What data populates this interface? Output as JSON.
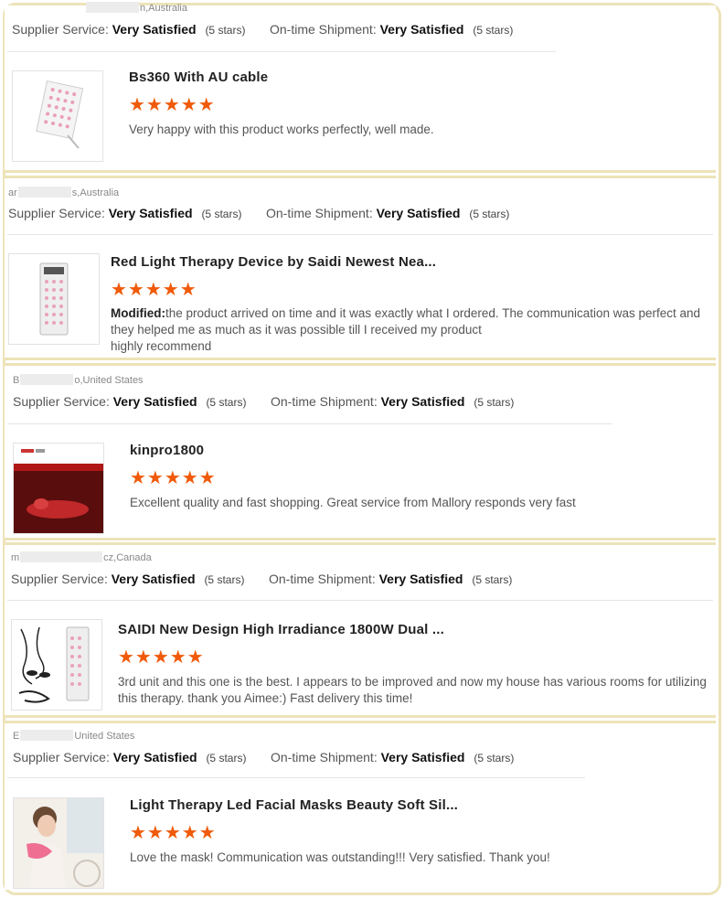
{
  "reviews": [
    {
      "buyer_prefix": "",
      "buyer_suffix": "n,Australia",
      "supplier_label": "Supplier Service:",
      "supplier_value": "Very Satisfied",
      "supplier_count": "(5 stars)",
      "shipment_label": "On-time Shipment:",
      "shipment_value": "Very Satisfied",
      "shipment_count": "(5 stars)",
      "product_title": "Bs360 With AU cable",
      "stars": "★★★★★",
      "rating": 5,
      "modified_label": "",
      "text": "Very happy with this product works perfectly, well made."
    },
    {
      "buyer_prefix": "ar",
      "buyer_suffix": "s,Australia",
      "supplier_label": "Supplier Service:",
      "supplier_value": "Very Satisfied",
      "supplier_count": "(5 stars)",
      "shipment_label": "On-time Shipment:",
      "shipment_value": "Very Satisfied",
      "shipment_count": "(5 stars)",
      "product_title": "Red Light Therapy Device by Saidi Newest Nea...",
      "stars": "★★★★★",
      "rating": 5,
      "modified_label": "Modified:",
      "text": "the product arrived on time and it was exactly what I ordered. The communication was perfect and they helped me as much as it was possible till I received my product",
      "text2": "highly recommend"
    },
    {
      "buyer_prefix": "B",
      "buyer_suffix": "o,United States",
      "supplier_label": "Supplier Service:",
      "supplier_value": "Very Satisfied",
      "supplier_count": "(5 stars)",
      "shipment_label": "On-time Shipment:",
      "shipment_value": "Very Satisfied",
      "shipment_count": "(5 stars)",
      "product_title": "kinpro1800",
      "stars": "★★★★★",
      "rating": 5,
      "modified_label": "",
      "text": "Excellent quality and fast shopping. Great service from Mallory responds very fast"
    },
    {
      "buyer_prefix": "m",
      "buyer_suffix": "cz,Canada",
      "supplier_label": "Supplier Service:",
      "supplier_value": "Very Satisfied",
      "supplier_count": "(5 stars)",
      "shipment_label": "On-time Shipment:",
      "shipment_value": "Very Satisfied",
      "shipment_count": "(5 stars)",
      "product_title": "SAIDI New Design High Irradiance 1800W Dual ...",
      "stars": "★★★★★",
      "rating": 5,
      "modified_label": "",
      "text": "3rd unit and this one is the best. I appears to be improved and now my house has various rooms for utilizing this therapy. thank you Aimee:) Fast delivery this time!"
    },
    {
      "buyer_prefix": "E",
      "buyer_suffix": "United States",
      "supplier_label": "Supplier Service:",
      "supplier_value": "Very Satisfied",
      "supplier_count": "(5 stars)",
      "shipment_label": "On-time Shipment:",
      "shipment_value": "Very Satisfied",
      "shipment_count": "(5 stars)",
      "product_title": "Light Therapy Led Facial Masks Beauty Soft Sil...",
      "stars": "★★★★★",
      "rating": 5,
      "modified_label": "",
      "text": "Love the mask! Communication was outstanding!!! Very satisfied. Thank you!"
    }
  ],
  "colors": {
    "accent_star": "#f05a0a",
    "card_border": "#ece3b8",
    "divider": "#e5e5e5"
  },
  "icons": [
    "star-icon"
  ]
}
